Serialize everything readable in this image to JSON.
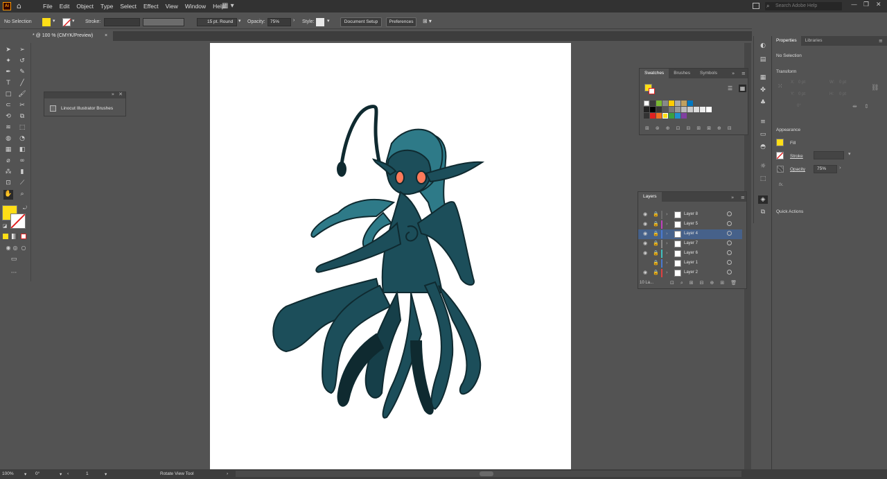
{
  "app": {
    "logo": "Ai",
    "menus": [
      "File",
      "Edit",
      "Object",
      "Type",
      "Select",
      "Effect",
      "View",
      "Window",
      "Help"
    ],
    "search_placeholder": "Search Adobe Help"
  },
  "control_bar": {
    "selection": "No Selection",
    "stroke_label": "Stroke:",
    "brush_value": "15 pt. Round",
    "opacity_label": "Opacity:",
    "opacity_value": "75%",
    "style_label": "Style:",
    "document_setup": "Document Setup",
    "preferences": "Preferences"
  },
  "doc_tab": {
    "label": "* @ 100 % (CMYK/Preview)",
    "close": "×"
  },
  "brushes_panel": {
    "item": "Linocut Illustrator Brushes"
  },
  "swatches_panel": {
    "tabs": [
      "Swatches",
      "Brushes",
      "Symbols"
    ]
  },
  "layers_panel": {
    "title": "Layers",
    "layers": [
      {
        "name": "Layer 8",
        "color": "#6b6b6b"
      },
      {
        "name": "Layer 5",
        "color": "#c040c0"
      },
      {
        "name": "Layer 4",
        "color": "#4a7ad0",
        "selected": true
      },
      {
        "name": "Layer 7",
        "color": "#8a8a8a"
      },
      {
        "name": "Layer 6",
        "color": "#40c0c0"
      },
      {
        "name": "Layer 1",
        "color": "#4a7ad0"
      },
      {
        "name": "Layer 2",
        "color": "#e04040"
      }
    ],
    "count": "10 La..."
  },
  "properties_panel": {
    "tabs": [
      "Properties",
      "Libraries"
    ],
    "selection": "No Selection",
    "transform": "Transform",
    "x": "X:",
    "y": "Y:",
    "w": "W:",
    "h": "H:",
    "x_val": "0 pt",
    "y_val": "0 pt",
    "w_val": "0 pt",
    "h_val": "0 pt",
    "angle_val": "0°",
    "appearance": "Appearance",
    "fill": "Fill",
    "stroke": "Stroke",
    "opacity": "Opacity",
    "opacity_value": "75%",
    "fx": "fx.",
    "quick_actions": "Quick Actions"
  },
  "status_bar": {
    "zoom": "100%",
    "rotation": "0°",
    "artboard": "1",
    "tool": "Rotate View Tool"
  },
  "colors": {
    "fill": "#ffde17",
    "artwork_body": "#1c4e5a",
    "artwork_light": "#2e7a88",
    "artwork_dark": "#0f2a30",
    "eyes": "#ff7a5a"
  }
}
